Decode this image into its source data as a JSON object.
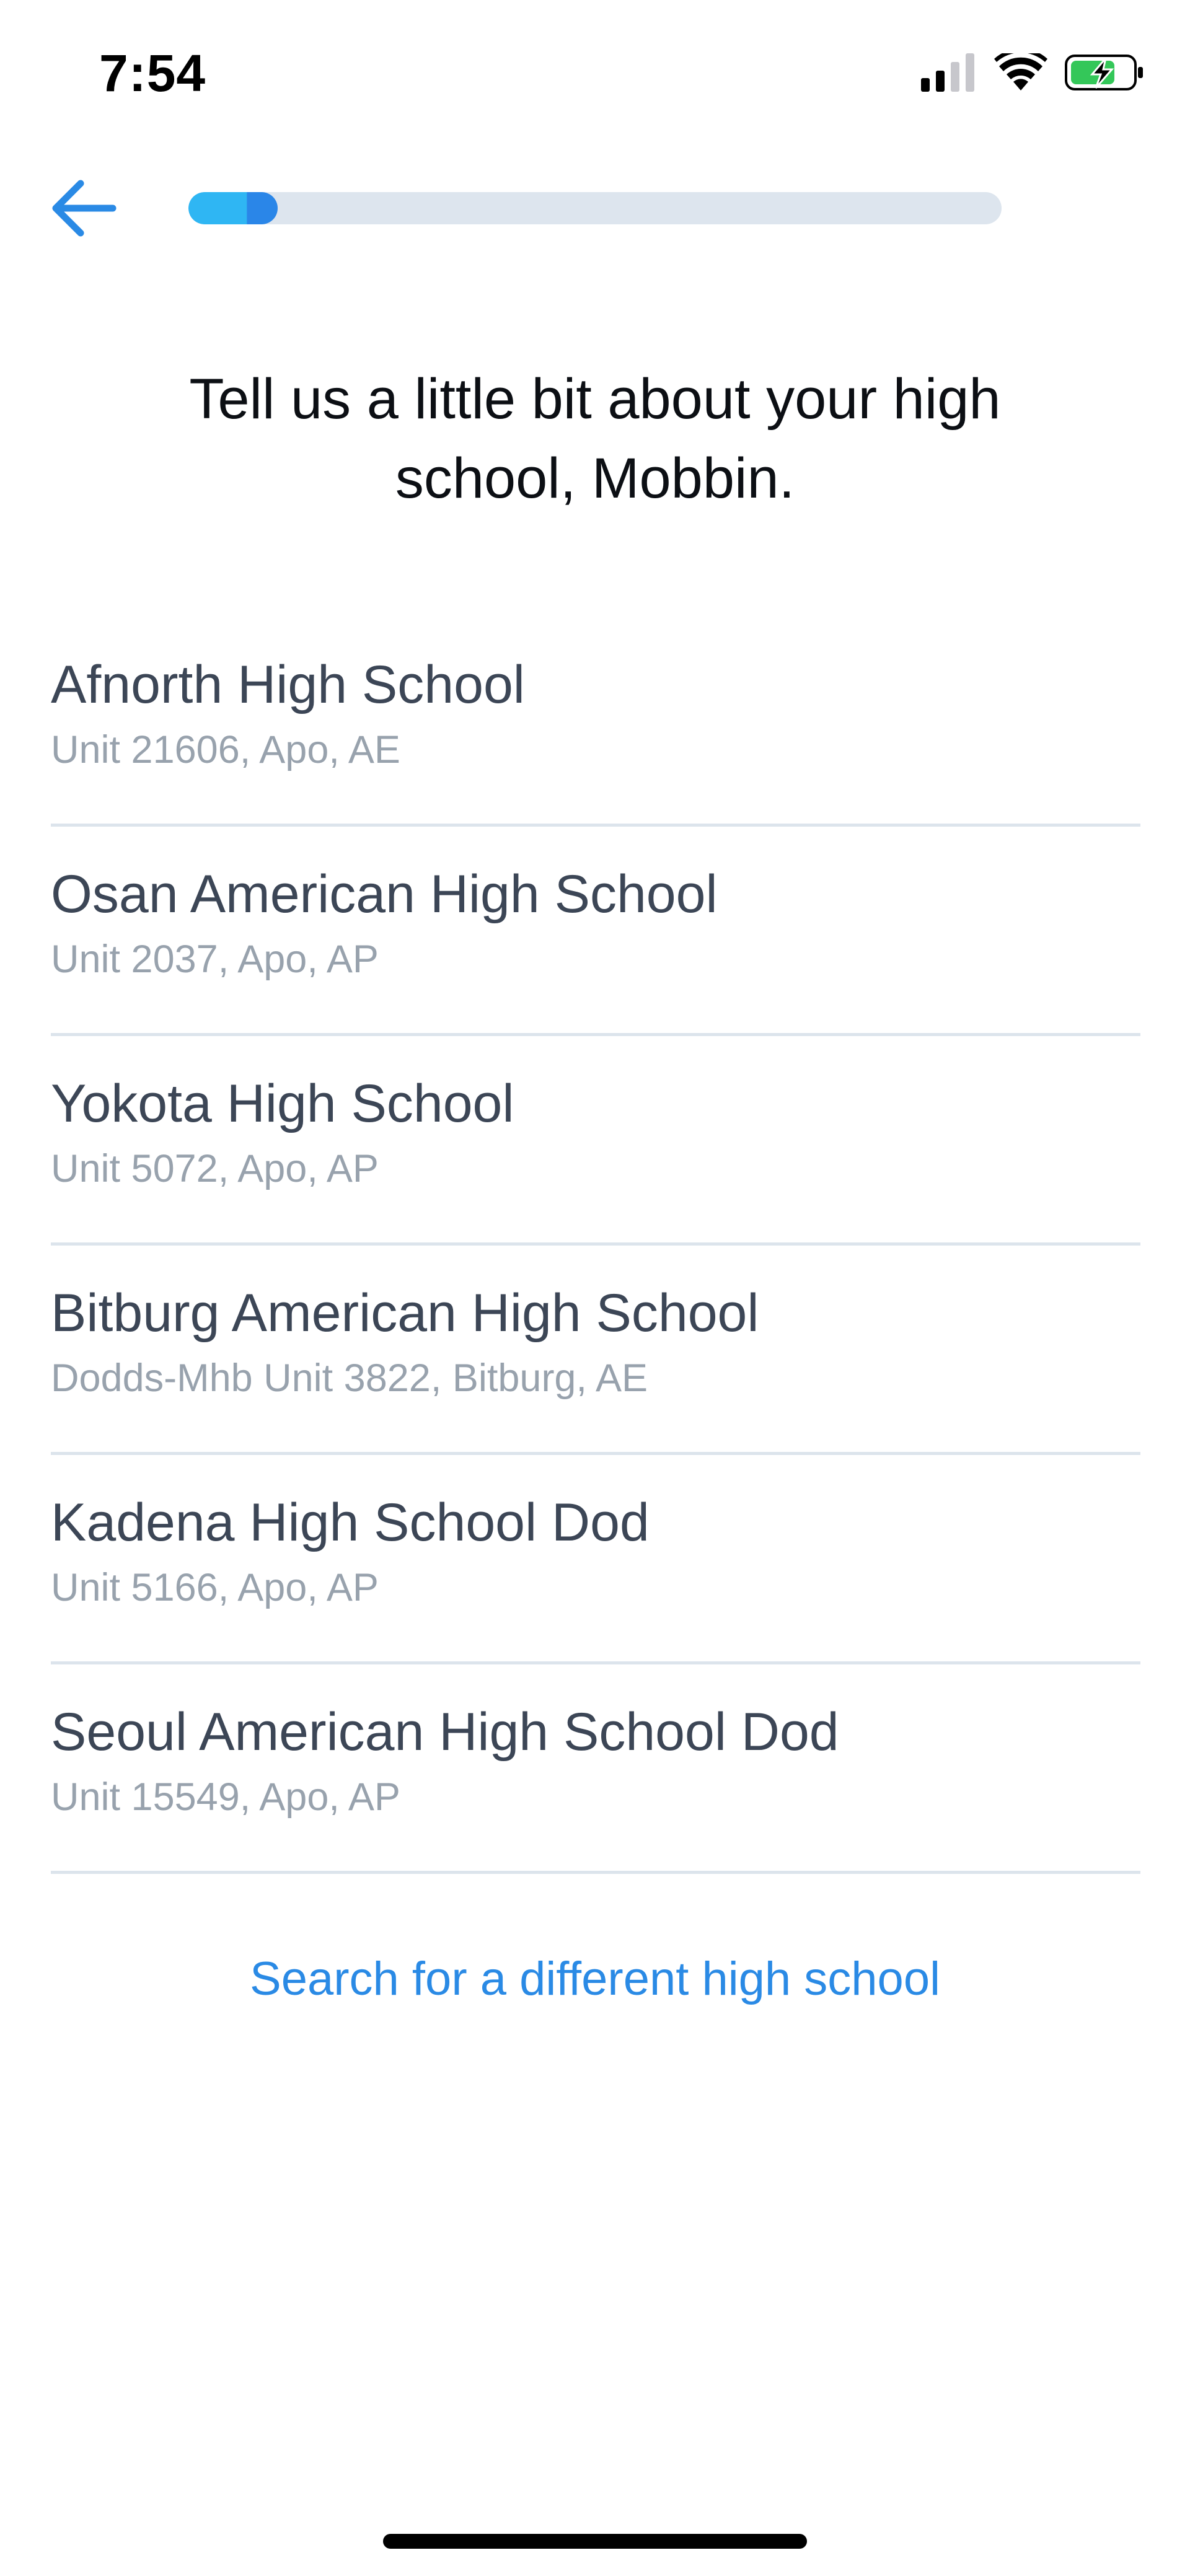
{
  "status_bar": {
    "time": "7:54",
    "icons": [
      "cellular-signal-icon",
      "wifi-icon",
      "battery-charging-icon"
    ]
  },
  "nav": {
    "back_icon": "arrow-left-icon",
    "progress_fraction": 0.11
  },
  "heading": "Tell us a little bit about your high school, Mobbin.",
  "schools": [
    {
      "name": "Afnorth High School",
      "address": "Unit 21606, Apo, AE"
    },
    {
      "name": "Osan American High School",
      "address": "Unit 2037, Apo, AP"
    },
    {
      "name": "Yokota High School",
      "address": "Unit 5072, Apo, AP"
    },
    {
      "name": "Bitburg American High School",
      "address": "Dodds-Mhb Unit 3822, Bitburg, AE"
    },
    {
      "name": "Kadena High School Dod",
      "address": "Unit 5166, Apo, AP"
    },
    {
      "name": "Seoul American High School Dod",
      "address": "Unit 15549, Apo, AP"
    }
  ],
  "search_link": "Search for a different high school",
  "colors": {
    "accent": "#2a8ae5",
    "progress_start": "#2fb6f3",
    "progress_end": "#2a86e8",
    "track": "#dde5ee",
    "school_name": "#3c4656",
    "school_address": "#98a2ad",
    "divider": "#dce4ec"
  }
}
